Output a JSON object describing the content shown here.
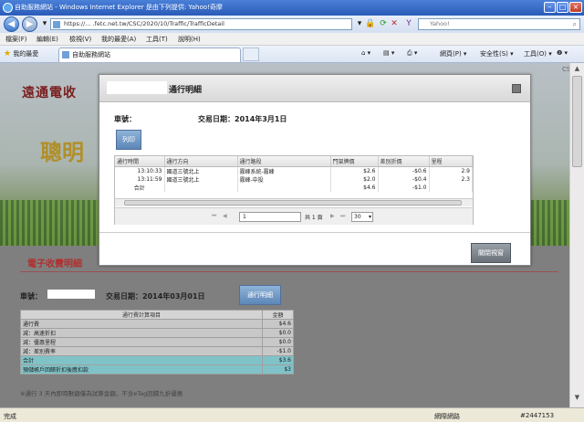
{
  "browser": {
    "title": "自助服務網站 - Windows Internet Explorer 是由下列提供: Yahoo!奇摩",
    "url": "https://... .fetc.net.tw/CSC/2020/10/Traffic/TrafficDetail",
    "search_placeholder": "Yahoo!",
    "menu": [
      "檔案(F)",
      "編輯(E)",
      "檢視(V)",
      "我的最愛(A)",
      "工具(T)",
      "說明(H)"
    ],
    "favorites_label": "我的最愛",
    "tab_label": "自助服務網站",
    "right_tools": [
      "網頁(P) ▾",
      "安全性(S) ▾",
      "工具(O) ▾",
      "❷ ▾"
    ],
    "status": "完成",
    "zone": "網際網路",
    "zoom": "#2447153"
  },
  "site": {
    "logo": "遠通電收",
    "slogan": "聰明",
    "corner_text": "CS"
  },
  "section": {
    "title": "電子收費明細",
    "car_label": "車號：",
    "date_label": "交易日期：2014年03月01日",
    "detail_button": "通行明細",
    "fee_header_item": "通行費計算項目",
    "fee_header_amount": "金額",
    "fee_rows": [
      {
        "item": "通行費",
        "amount": "$4.6"
      },
      {
        "item": "減：高速折扣",
        "amount": "$0.0"
      },
      {
        "item": "減：優惠里程",
        "amount": "$0.0"
      },
      {
        "item": "減：差別費率",
        "amount": "-$1.0"
      },
      {
        "item": "合計",
        "amount": "$3.6"
      },
      {
        "item": "預儲帳戶回饋折扣後應扣款",
        "amount": "$3"
      }
    ],
    "footnote": "※通行 3 天內即時數額僅為試算金額，不含eTag回饋九折優惠"
  },
  "modal": {
    "title": "通行明細",
    "car_label": "車號：",
    "date_label": "交易日期：2014年3月1日",
    "print_button": "列印",
    "columns": [
      "通行時間",
      "通行方向",
      "通行路段",
      "門架牌價",
      "差別折價",
      "里程"
    ],
    "rows": [
      {
        "time": "13:10:33",
        "direction": "國道三號北上",
        "segment": "霧峰系統-霧峰",
        "price": "$2.6",
        "discount": "-$0.6",
        "km": "2.9"
      },
      {
        "time": "13:11:59",
        "direction": "國道三號北上",
        "segment": "霧峰-中投",
        "price": "$2.0",
        "discount": "-$0.4",
        "km": "2.3"
      },
      {
        "time": "合計",
        "direction": "",
        "segment": "",
        "price": "$4.6",
        "discount": "-$1.0",
        "km": ""
      }
    ],
    "pager": {
      "page": "1",
      "of": "共 1 頁",
      "rows_per_page": "30"
    },
    "close_button": "關閉視窗"
  }
}
